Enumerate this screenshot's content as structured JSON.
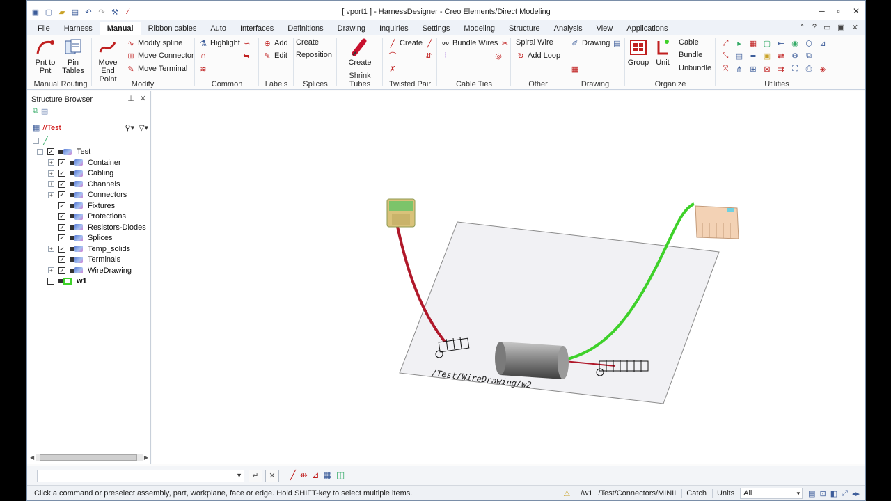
{
  "window": {
    "title": "[ vport1 ] - HarnessDesigner - Creo Elements/Direct Modeling",
    "controls": [
      "minimize",
      "maximize",
      "close"
    ]
  },
  "ribbon": {
    "tabs": [
      "File",
      "Harness",
      "Manual",
      "Ribbon cables",
      "Auto",
      "Interfaces",
      "Definitions",
      "Drawing",
      "Inquiries",
      "Settings",
      "Modeling",
      "Structure",
      "Analysis",
      "View",
      "Applications"
    ],
    "active_tab": "Manual",
    "groups": {
      "manual_routing": {
        "label": "Manual Routing",
        "pnt_to_pnt": "Pnt to Pnt",
        "pin_tables": "Pin Tables"
      },
      "modify": {
        "label": "Modify",
        "move_end_point": "Move End Point",
        "modify_spline": "Modify spline",
        "move_connector": "Move Connector",
        "move_terminal": "Move Terminal"
      },
      "common": {
        "label": "Common",
        "highlight": "Highlight"
      },
      "labels": {
        "label": "Labels",
        "add": "Add",
        "edit": "Edit"
      },
      "splices": {
        "label": "Splices",
        "create": "Create",
        "reposition": "Reposition"
      },
      "shrink_tubes": {
        "label": "Shrink Tubes",
        "create": "Create"
      },
      "twisted_pair": {
        "label": "Twisted Pair",
        "create": "Create"
      },
      "cable_ties": {
        "label": "Cable Ties",
        "bundle_wires": "Bundle Wires"
      },
      "other": {
        "label": "Other",
        "spiral_wire": "Spiral Wire",
        "add_loop": "Add Loop"
      },
      "drawing": {
        "label": "Drawing",
        "drawing": "Drawing"
      },
      "organize": {
        "label": "Organize",
        "group": "Group",
        "unit": "Unit",
        "cable": "Cable",
        "bundle": "Bundle",
        "unbundle": "Unbundle"
      },
      "utilities": {
        "label": "Utilities"
      }
    }
  },
  "structure_browser": {
    "title": "Structure Browser",
    "path": "//Test",
    "tree": [
      {
        "label": "Test",
        "level": 0,
        "expander": "-",
        "checked": true
      },
      {
        "label": "Container",
        "level": 1,
        "expander": "+",
        "checked": true
      },
      {
        "label": "Cabling",
        "level": 1,
        "expander": "+",
        "checked": true
      },
      {
        "label": "Channels",
        "level": 1,
        "expander": "+",
        "checked": true
      },
      {
        "label": "Connectors",
        "level": 1,
        "expander": "+",
        "checked": true
      },
      {
        "label": "Fixtures",
        "level": 1,
        "expander": "",
        "checked": true
      },
      {
        "label": "Protections",
        "level": 1,
        "expander": "",
        "checked": true
      },
      {
        "label": "Resistors-Diodes",
        "level": 1,
        "expander": "",
        "checked": true
      },
      {
        "label": "Splices",
        "level": 1,
        "expander": "",
        "checked": true
      },
      {
        "label": "Temp_solids",
        "level": 1,
        "expander": "+",
        "checked": true
      },
      {
        "label": "Terminals",
        "level": 1,
        "expander": "",
        "checked": true
      },
      {
        "label": "WireDrawing",
        "level": 1,
        "expander": "+",
        "checked": true
      },
      {
        "label": "w1",
        "level": 0,
        "expander": "",
        "checked": false
      }
    ]
  },
  "viewport": {
    "workplane_label": "/Test/WireDrawing/w2",
    "wire_colors": {
      "red": "#b0182a",
      "green": "#3ed12a"
    }
  },
  "command_line": {
    "input_value": ""
  },
  "status_bar": {
    "message": "Click a command or preselect assembly, part, workplane, face or edge. Hold SHIFT-key to select multiple items.",
    "workplane": "/w1",
    "part": "/Test/Connectors/MINII",
    "catch": "Catch",
    "units_label": "Units",
    "units_value": "All"
  }
}
